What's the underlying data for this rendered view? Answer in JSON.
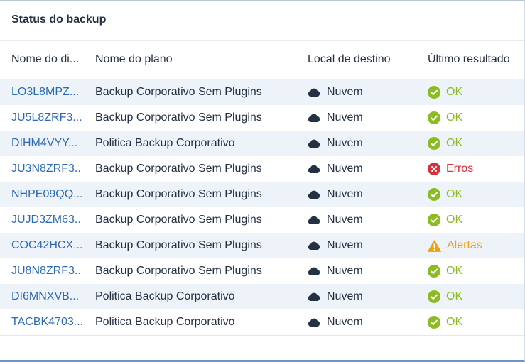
{
  "widget": {
    "title": "Status do backup"
  },
  "columns": {
    "device": "Nome do di...",
    "plan": "Nome do plano",
    "destination": "Local de destino",
    "result": "Último resultado"
  },
  "rows": [
    {
      "device": "LO3L8MPZ...",
      "plan": "Backup Corporativo Sem Plugins",
      "destination": "Nuvem",
      "result": "OK",
      "status": "ok"
    },
    {
      "device": "JU5L8ZRF3...",
      "plan": "Backup Corporativo Sem Plugins",
      "destination": "Nuvem",
      "result": "OK",
      "status": "ok"
    },
    {
      "device": "DIHM4VYY...",
      "plan": "Politica Backup Corporativo",
      "destination": "Nuvem",
      "result": "OK",
      "status": "ok"
    },
    {
      "device": "JU3N8ZRF3...",
      "plan": "Backup Corporativo Sem Plugins",
      "destination": "Nuvem",
      "result": "Erros",
      "status": "error"
    },
    {
      "device": "NHPE09QQ...",
      "plan": "Backup Corporativo Sem Plugins",
      "destination": "Nuvem",
      "result": "OK",
      "status": "ok"
    },
    {
      "device": "JUJD3ZM63...",
      "plan": "Backup Corporativo Sem Plugins",
      "destination": "Nuvem",
      "result": "OK",
      "status": "ok"
    },
    {
      "device": "COC42HCX...",
      "plan": "Backup Corporativo Sem Plugins",
      "destination": "Nuvem",
      "result": "Alertas",
      "status": "warning"
    },
    {
      "device": "JU8N8ZRF3...",
      "plan": "Backup Corporativo Sem Plugins",
      "destination": "Nuvem",
      "result": "OK",
      "status": "ok"
    },
    {
      "device": "DI6MNXVB...",
      "plan": "Politica Backup Corporativo",
      "destination": "Nuvem",
      "result": "OK",
      "status": "ok"
    },
    {
      "device": "TACBK4703...",
      "plan": "Politica Backup Corporativo",
      "destination": "Nuvem",
      "result": "OK",
      "status": "ok"
    }
  ],
  "colors": {
    "link": "#2b6ab8",
    "ok": "#8dbb24",
    "error": "#d8313a",
    "warning": "#eca012",
    "row_stripe": "#eef3fa"
  },
  "icons": {
    "destination": "cloud-icon",
    "ok": "check-circle-icon",
    "error": "x-circle-icon",
    "warning": "warning-triangle-icon"
  }
}
